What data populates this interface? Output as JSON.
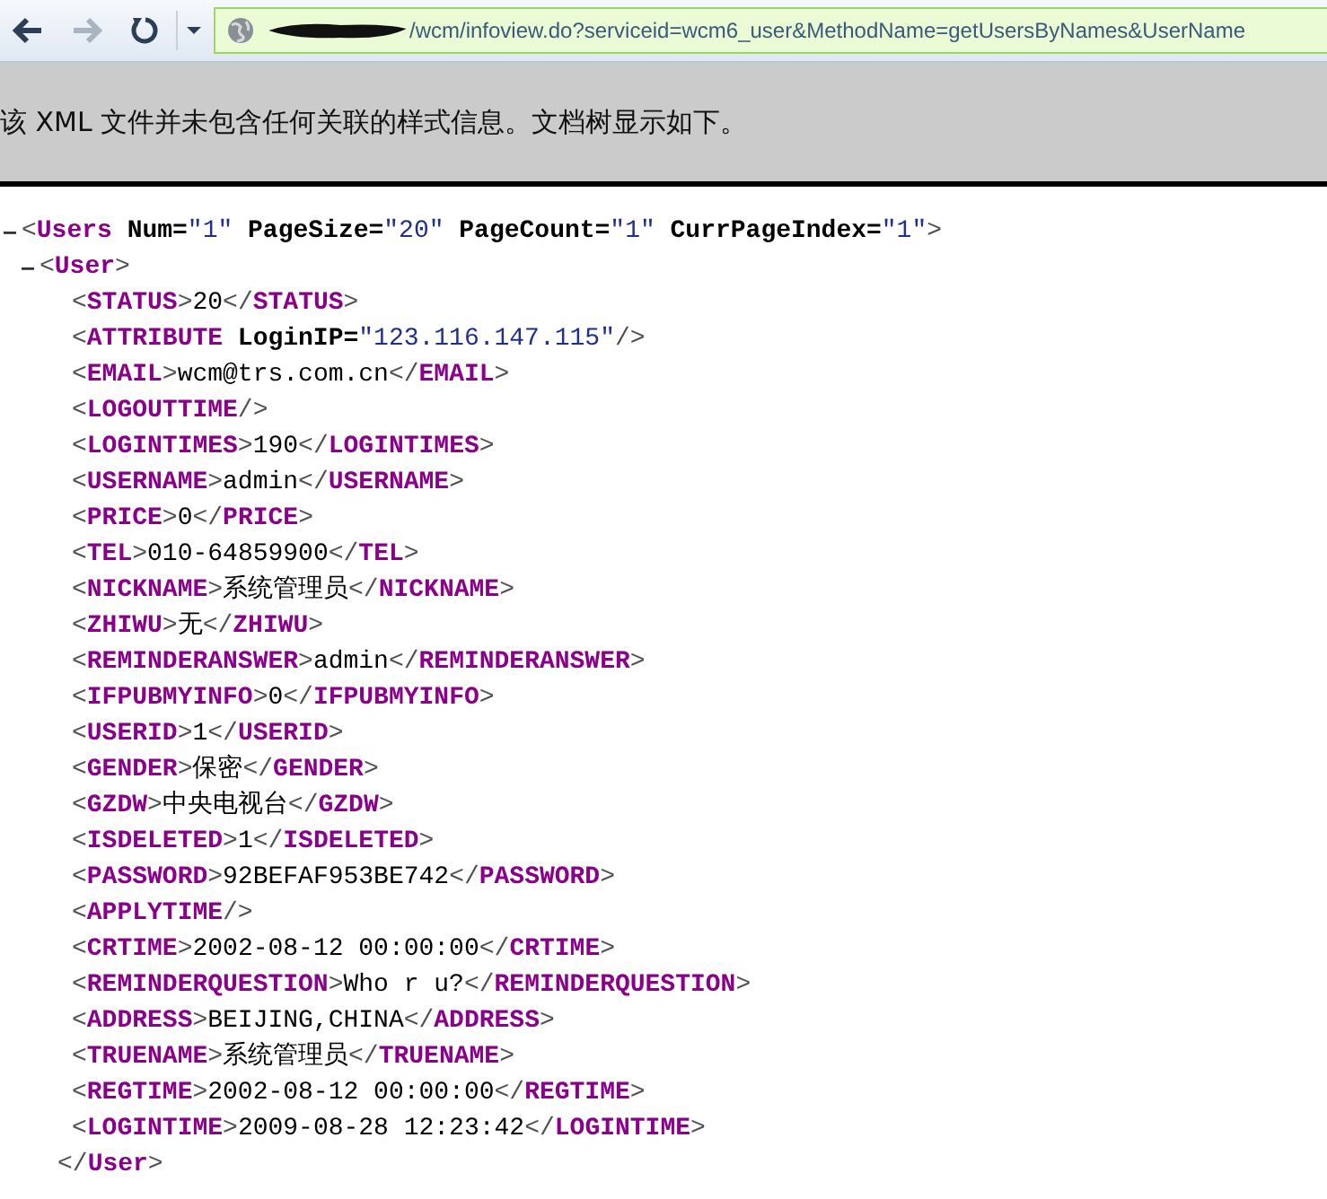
{
  "toolbar": {
    "buttons": [
      {
        "kind": "back",
        "disabled": false
      },
      {
        "kind": "forward",
        "disabled": true
      },
      {
        "kind": "refresh",
        "disabled": false
      },
      {
        "kind": "history",
        "disabled": false
      }
    ],
    "address_bar": {
      "redacted": true,
      "value": "/wcm/infoview.do?serviceid=wcm6_user&MethodName=getUsersByNames&UserName"
    }
  },
  "info_bar": {
    "message": "该 XML 文件并未包含任何关联的样式信息。文档树显示如下。"
  },
  "xml_tree": {
    "expanded": true,
    "open_tag": [
      {
        "kind": "bracket",
        "text": "<"
      },
      {
        "kind": "tag",
        "text": "Users"
      },
      {
        "kind": "attr",
        "text": "Num="
      },
      {
        "kind": "value",
        "text": "\"1\""
      },
      {
        "kind": "attr",
        "text": "PageSize="
      },
      {
        "kind": "value",
        "text": "\"20\""
      },
      {
        "kind": "attr",
        "text": "PageCount="
      },
      {
        "kind": "value",
        "text": "\"1\""
      },
      {
        "kind": "attr",
        "text": "CurrPageIndex="
      },
      {
        "kind": "value",
        "text": "\"1\""
      },
      {
        "kind": "bracket",
        "text": ">"
      }
    ],
    "children": [
      {
        "expanded": true,
        "open_tag": [
          {
            "kind": "bracket",
            "text": "<"
          },
          {
            "kind": "tag",
            "text": "User"
          },
          {
            "kind": "bracket",
            "text": ">"
          }
        ],
        "children": [
          {
            "line": [
              {
                "kind": "bracket",
                "text": "<"
              },
              {
                "kind": "tag",
                "text": "STATUS"
              },
              {
                "kind": "bracket",
                "text": ">"
              },
              {
                "kind": "text",
                "text": "20"
              },
              {
                "kind": "bracket",
                "text": "</"
              },
              {
                "kind": "tag",
                "text": "STATUS"
              },
              {
                "kind": "bracket",
                "text": ">"
              }
            ]
          },
          {
            "line": [
              {
                "kind": "bracket",
                "text": "<"
              },
              {
                "kind": "tag",
                "text": "ATTRIBUTE"
              },
              {
                "kind": "attr",
                "text": "LoginIP="
              },
              {
                "kind": "value",
                "text": "\"123.116.147.115\""
              },
              {
                "kind": "bracket",
                "text": "/>"
              }
            ]
          },
          {
            "line": [
              {
                "kind": "bracket",
                "text": "<"
              },
              {
                "kind": "tag",
                "text": "EMAIL"
              },
              {
                "kind": "bracket",
                "text": ">"
              },
              {
                "kind": "text",
                "text": "wcm@trs.com.cn"
              },
              {
                "kind": "bracket",
                "text": "</"
              },
              {
                "kind": "tag",
                "text": "EMAIL"
              },
              {
                "kind": "bracket",
                "text": ">"
              }
            ]
          },
          {
            "line": [
              {
                "kind": "bracket",
                "text": "<"
              },
              {
                "kind": "tag",
                "text": "LOGOUTTIME"
              },
              {
                "kind": "bracket",
                "text": "/>"
              }
            ]
          },
          {
            "line": [
              {
                "kind": "bracket",
                "text": "<"
              },
              {
                "kind": "tag",
                "text": "LOGINTIMES"
              },
              {
                "kind": "bracket",
                "text": ">"
              },
              {
                "kind": "text",
                "text": "190"
              },
              {
                "kind": "bracket",
                "text": "</"
              },
              {
                "kind": "tag",
                "text": "LOGINTIMES"
              },
              {
                "kind": "bracket",
                "text": ">"
              }
            ]
          },
          {
            "line": [
              {
                "kind": "bracket",
                "text": "<"
              },
              {
                "kind": "tag",
                "text": "USERNAME"
              },
              {
                "kind": "bracket",
                "text": ">"
              },
              {
                "kind": "text",
                "text": "admin"
              },
              {
                "kind": "bracket",
                "text": "</"
              },
              {
                "kind": "tag",
                "text": "USERNAME"
              },
              {
                "kind": "bracket",
                "text": ">"
              }
            ]
          },
          {
            "line": [
              {
                "kind": "bracket",
                "text": "<"
              },
              {
                "kind": "tag",
                "text": "PRICE"
              },
              {
                "kind": "bracket",
                "text": ">"
              },
              {
                "kind": "text",
                "text": "0"
              },
              {
                "kind": "bracket",
                "text": "</"
              },
              {
                "kind": "tag",
                "text": "PRICE"
              },
              {
                "kind": "bracket",
                "text": ">"
              }
            ]
          },
          {
            "line": [
              {
                "kind": "bracket",
                "text": "<"
              },
              {
                "kind": "tag",
                "text": "TEL"
              },
              {
                "kind": "bracket",
                "text": ">"
              },
              {
                "kind": "text",
                "text": "010-64859900"
              },
              {
                "kind": "bracket",
                "text": "</"
              },
              {
                "kind": "tag",
                "text": "TEL"
              },
              {
                "kind": "bracket",
                "text": ">"
              }
            ]
          },
          {
            "line": [
              {
                "kind": "bracket",
                "text": "<"
              },
              {
                "kind": "tag",
                "text": "NICKNAME"
              },
              {
                "kind": "bracket",
                "text": ">"
              },
              {
                "kind": "text",
                "text": "系统管理员"
              },
              {
                "kind": "bracket",
                "text": "</"
              },
              {
                "kind": "tag",
                "text": "NICKNAME"
              },
              {
                "kind": "bracket",
                "text": ">"
              }
            ]
          },
          {
            "line": [
              {
                "kind": "bracket",
                "text": "<"
              },
              {
                "kind": "tag",
                "text": "ZHIWU"
              },
              {
                "kind": "bracket",
                "text": ">"
              },
              {
                "kind": "text",
                "text": "无"
              },
              {
                "kind": "bracket",
                "text": "</"
              },
              {
                "kind": "tag",
                "text": "ZHIWU"
              },
              {
                "kind": "bracket",
                "text": ">"
              }
            ]
          },
          {
            "line": [
              {
                "kind": "bracket",
                "text": "<"
              },
              {
                "kind": "tag",
                "text": "REMINDERANSWER"
              },
              {
                "kind": "bracket",
                "text": ">"
              },
              {
                "kind": "text",
                "text": "admin"
              },
              {
                "kind": "bracket",
                "text": "</"
              },
              {
                "kind": "tag",
                "text": "REMINDERANSWER"
              },
              {
                "kind": "bracket",
                "text": ">"
              }
            ]
          },
          {
            "line": [
              {
                "kind": "bracket",
                "text": "<"
              },
              {
                "kind": "tag",
                "text": "IFPUBMYINFO"
              },
              {
                "kind": "bracket",
                "text": ">"
              },
              {
                "kind": "text",
                "text": "0"
              },
              {
                "kind": "bracket",
                "text": "</"
              },
              {
                "kind": "tag",
                "text": "IFPUBMYINFO"
              },
              {
                "kind": "bracket",
                "text": ">"
              }
            ]
          },
          {
            "line": [
              {
                "kind": "bracket",
                "text": "<"
              },
              {
                "kind": "tag",
                "text": "USERID"
              },
              {
                "kind": "bracket",
                "text": ">"
              },
              {
                "kind": "text",
                "text": "1"
              },
              {
                "kind": "bracket",
                "text": "</"
              },
              {
                "kind": "tag",
                "text": "USERID"
              },
              {
                "kind": "bracket",
                "text": ">"
              }
            ]
          },
          {
            "line": [
              {
                "kind": "bracket",
                "text": "<"
              },
              {
                "kind": "tag",
                "text": "GENDER"
              },
              {
                "kind": "bracket",
                "text": ">"
              },
              {
                "kind": "text",
                "text": "保密"
              },
              {
                "kind": "bracket",
                "text": "</"
              },
              {
                "kind": "tag",
                "text": "GENDER"
              },
              {
                "kind": "bracket",
                "text": ">"
              }
            ]
          },
          {
            "line": [
              {
                "kind": "bracket",
                "text": "<"
              },
              {
                "kind": "tag",
                "text": "GZDW"
              },
              {
                "kind": "bracket",
                "text": ">"
              },
              {
                "kind": "text",
                "text": "中央电视台"
              },
              {
                "kind": "bracket",
                "text": "</"
              },
              {
                "kind": "tag",
                "text": "GZDW"
              },
              {
                "kind": "bracket",
                "text": ">"
              }
            ]
          },
          {
            "line": [
              {
                "kind": "bracket",
                "text": "<"
              },
              {
                "kind": "tag",
                "text": "ISDELETED"
              },
              {
                "kind": "bracket",
                "text": ">"
              },
              {
                "kind": "text",
                "text": "1"
              },
              {
                "kind": "bracket",
                "text": "</"
              },
              {
                "kind": "tag",
                "text": "ISDELETED"
              },
              {
                "kind": "bracket",
                "text": ">"
              }
            ]
          },
          {
            "line": [
              {
                "kind": "bracket",
                "text": "<"
              },
              {
                "kind": "tag",
                "text": "PASSWORD"
              },
              {
                "kind": "bracket",
                "text": ">"
              },
              {
                "kind": "text",
                "text": "92BEFAF953BE742"
              },
              {
                "kind": "bracket",
                "text": "</"
              },
              {
                "kind": "tag",
                "text": "PASSWORD"
              },
              {
                "kind": "bracket",
                "text": ">"
              }
            ]
          },
          {
            "line": [
              {
                "kind": "bracket",
                "text": "<"
              },
              {
                "kind": "tag",
                "text": "APPLYTIME"
              },
              {
                "kind": "bracket",
                "text": "/>"
              }
            ]
          },
          {
            "line": [
              {
                "kind": "bracket",
                "text": "<"
              },
              {
                "kind": "tag",
                "text": "CRTIME"
              },
              {
                "kind": "bracket",
                "text": ">"
              },
              {
                "kind": "text",
                "text": "2002-08-12 00:00:00"
              },
              {
                "kind": "bracket",
                "text": "</"
              },
              {
                "kind": "tag",
                "text": "CRTIME"
              },
              {
                "kind": "bracket",
                "text": ">"
              }
            ]
          },
          {
            "line": [
              {
                "kind": "bracket",
                "text": "<"
              },
              {
                "kind": "tag",
                "text": "REMINDERQUESTION"
              },
              {
                "kind": "bracket",
                "text": ">"
              },
              {
                "kind": "text",
                "text": "Who r u?"
              },
              {
                "kind": "bracket",
                "text": "</"
              },
              {
                "kind": "tag",
                "text": "REMINDERQUESTION"
              },
              {
                "kind": "bracket",
                "text": ">"
              }
            ]
          },
          {
            "line": [
              {
                "kind": "bracket",
                "text": "<"
              },
              {
                "kind": "tag",
                "text": "ADDRESS"
              },
              {
                "kind": "bracket",
                "text": ">"
              },
              {
                "kind": "text",
                "text": "BEIJING,CHINA"
              },
              {
                "kind": "bracket",
                "text": "</"
              },
              {
                "kind": "tag",
                "text": "ADDRESS"
              },
              {
                "kind": "bracket",
                "text": ">"
              }
            ]
          },
          {
            "line": [
              {
                "kind": "bracket",
                "text": "<"
              },
              {
                "kind": "tag",
                "text": "TRUENAME"
              },
              {
                "kind": "bracket",
                "text": ">"
              },
              {
                "kind": "text",
                "text": "系统管理员"
              },
              {
                "kind": "bracket",
                "text": "</"
              },
              {
                "kind": "tag",
                "text": "TRUENAME"
              },
              {
                "kind": "bracket",
                "text": ">"
              }
            ]
          },
          {
            "line": [
              {
                "kind": "bracket",
                "text": "<"
              },
              {
                "kind": "tag",
                "text": "REGTIME"
              },
              {
                "kind": "bracket",
                "text": ">"
              },
              {
                "kind": "text",
                "text": "2002-08-12 00:00:00"
              },
              {
                "kind": "bracket",
                "text": "</"
              },
              {
                "kind": "tag",
                "text": "REGTIME"
              },
              {
                "kind": "bracket",
                "text": ">"
              }
            ]
          },
          {
            "line": [
              {
                "kind": "bracket",
                "text": "<"
              },
              {
                "kind": "tag",
                "text": "LOGINTIME"
              },
              {
                "kind": "bracket",
                "text": ">"
              },
              {
                "kind": "text",
                "text": "2009-08-28 12:23:42"
              },
              {
                "kind": "bracket",
                "text": "</"
              },
              {
                "kind": "tag",
                "text": "LOGINTIME"
              },
              {
                "kind": "bracket",
                "text": ">"
              }
            ]
          }
        ],
        "close_tag": [
          {
            "kind": "bracket",
            "text": "</"
          },
          {
            "kind": "tag",
            "text": "User"
          },
          {
            "kind": "bracket",
            "text": ">"
          }
        ]
      }
    ]
  }
}
